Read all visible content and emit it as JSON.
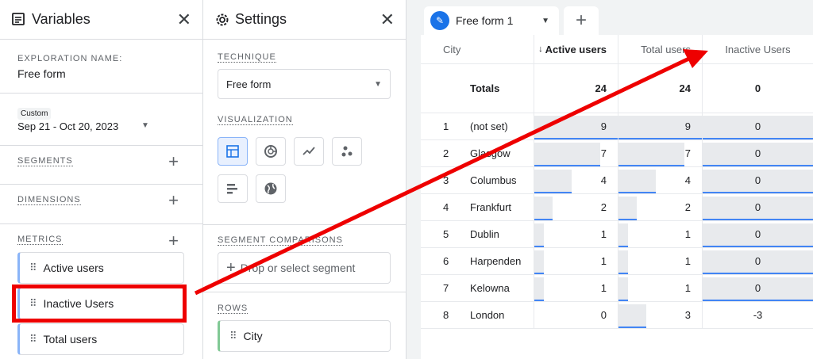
{
  "variables": {
    "title": "Variables",
    "exploration_label": "EXPLORATION NAME:",
    "exploration_name": "Free form",
    "date_badge": "Custom",
    "date_range": "Sep 21 - Oct 20, 2023",
    "segments_label": "SEGMENTS",
    "dimensions_label": "DIMENSIONS",
    "metrics_label": "METRICS",
    "metrics": [
      "Active users",
      "Inactive Users",
      "Total users"
    ]
  },
  "settings": {
    "title": "Settings",
    "technique_label": "TECHNIQUE",
    "technique_value": "Free form",
    "visualization_label": "VISUALIZATION",
    "segment_comparisons_label": "SEGMENT COMPARISONS",
    "segment_placeholder": "Drop or select segment",
    "rows_label": "ROWS",
    "rows_item": "City"
  },
  "tab": {
    "name": "Free form 1"
  },
  "table": {
    "headers": {
      "dim": "City",
      "active": "Active users",
      "total": "Total users",
      "inactive": "Inactive Users"
    },
    "totals": {
      "label": "Totals",
      "active": "24",
      "total": "24",
      "inactive": "0"
    },
    "rows": [
      {
        "n": "1",
        "city": "(not set)",
        "active": "9",
        "total": "9",
        "inactive": "0",
        "af": 1.0,
        "tf": 1.0,
        "if": 1.0
      },
      {
        "n": "2",
        "city": "Glasgow",
        "active": "7",
        "total": "7",
        "inactive": "0",
        "af": 0.78,
        "tf": 0.78,
        "if": 1.0
      },
      {
        "n": "3",
        "city": "Columbus",
        "active": "4",
        "total": "4",
        "inactive": "0",
        "af": 0.44,
        "tf": 0.44,
        "if": 1.0
      },
      {
        "n": "4",
        "city": "Frankfurt",
        "active": "2",
        "total": "2",
        "inactive": "0",
        "af": 0.22,
        "tf": 0.22,
        "if": 1.0
      },
      {
        "n": "5",
        "city": "Dublin",
        "active": "1",
        "total": "1",
        "inactive": "0",
        "af": 0.11,
        "tf": 0.11,
        "if": 1.0
      },
      {
        "n": "6",
        "city": "Harpenden",
        "active": "1",
        "total": "1",
        "inactive": "0",
        "af": 0.11,
        "tf": 0.11,
        "if": 1.0
      },
      {
        "n": "7",
        "city": "Kelowna",
        "active": "1",
        "total": "1",
        "inactive": "0",
        "af": 0.11,
        "tf": 0.11,
        "if": 1.0
      },
      {
        "n": "8",
        "city": "London",
        "active": "0",
        "total": "3",
        "inactive": "-3",
        "af": 0.0,
        "tf": 0.33,
        "if": 0.0
      }
    ]
  },
  "colors": {
    "accent": "#1a73e8",
    "highlight": "#e00000",
    "bar": "#4285f4"
  }
}
